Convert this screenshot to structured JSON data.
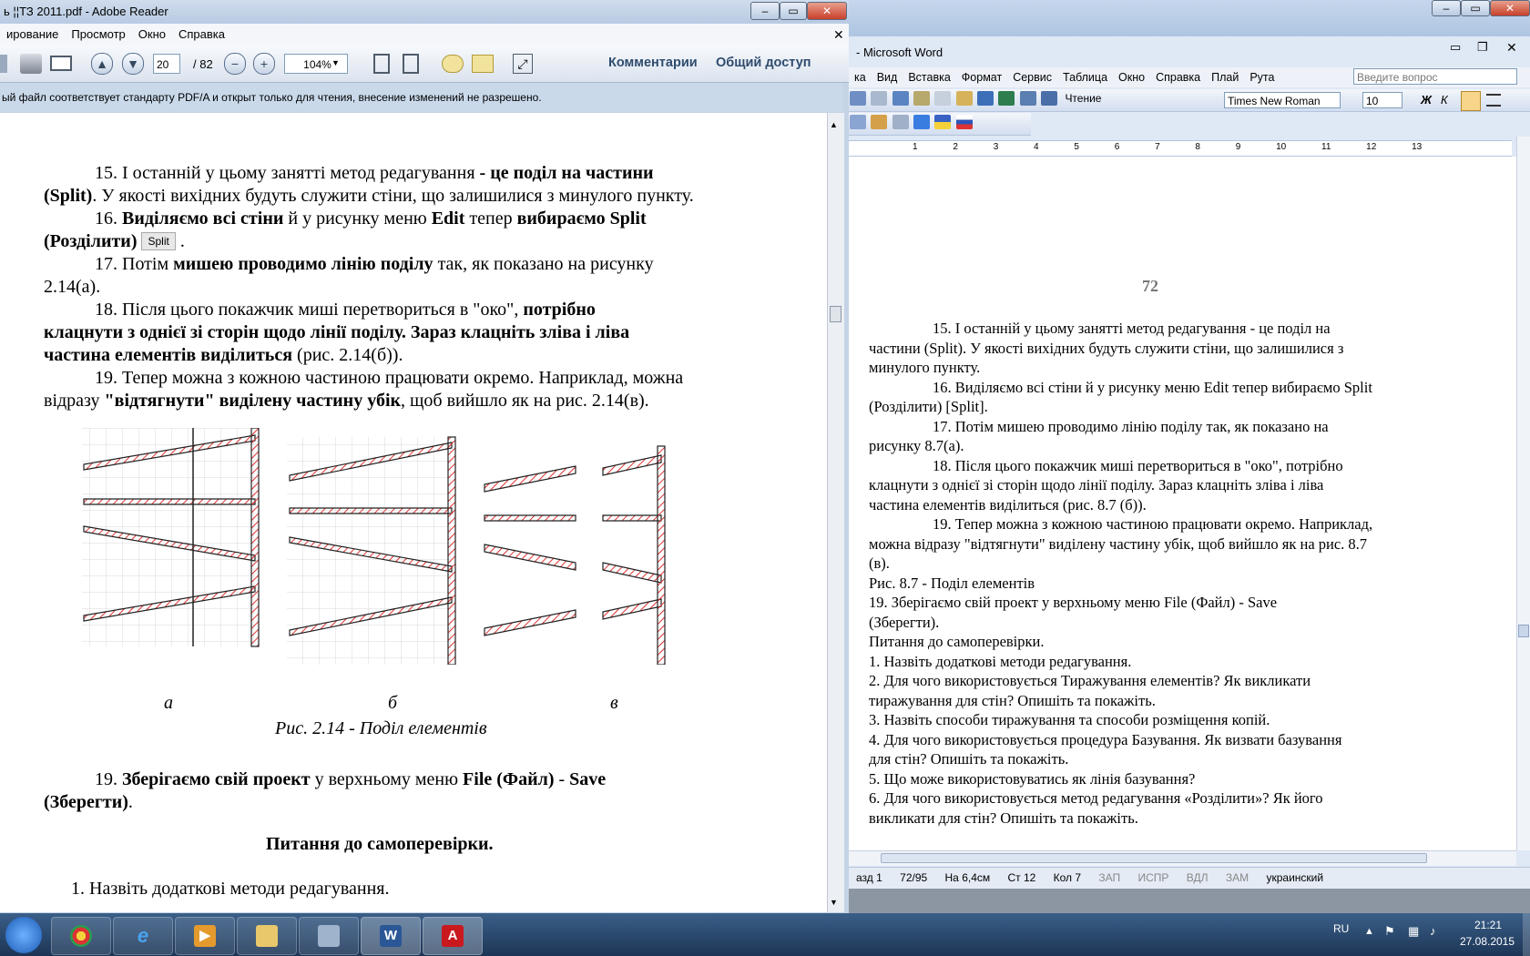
{
  "word": {
    "title": "- Microsoft Word",
    "menu": [
      "ка",
      "Вид",
      "Вставка",
      "Формат",
      "Сервис",
      "Таблица",
      "Окно",
      "Справка",
      "Плай",
      "Рута"
    ],
    "ask_placeholder": "Введите вопрос",
    "reading_label": "Чтение",
    "font_name": "Times New Roman",
    "font_size": "10",
    "bold_label": "Ж",
    "italic_label": "К",
    "ruler_numbers": [
      "1",
      "2",
      "3",
      "4",
      "5",
      "6",
      "7",
      "8",
      "9",
      "10",
      "11",
      "12",
      "13"
    ],
    "page_number": "72",
    "lines": [
      {
        "text": "15. І останній у цьому занятті метод редагування - це поділ на",
        "indent": true
      },
      {
        "text": "частини (Split). У якості вихідних будуть служити стіни, що залишилися з",
        "indent": false
      },
      {
        "text": "минулого пункту.",
        "indent": false
      },
      {
        "text": "16. Виділяємо всі стіни й у рисунку меню Edit тепер вибираємо Split",
        "indent": true
      },
      {
        "text": "(Розділити) [Split].",
        "indent": false
      },
      {
        "text": "17. Потім мишею проводимо лінію поділу так, як показано на",
        "indent": true
      },
      {
        "text": "рисунку 8.7(а).",
        "indent": false
      },
      {
        "text": "18. Після цього покажчик миші перетвориться в \"око\", потрібно",
        "indent": true
      },
      {
        "text": "клацнути з однієї зі сторін щодо лінії поділу. Зараз клацніть зліва і ліва",
        "indent": false
      },
      {
        "text": "частина елементів виділиться (рис. 8.7 (б)).",
        "indent": false
      },
      {
        "text": "19. Тепер можна з кожною частиною працювати окремо. Наприклад,",
        "indent": true
      },
      {
        "text": "можна відразу \"відтягнути\" виділену частину убік, щоб вийшло як на рис. 8.7",
        "indent": false
      },
      {
        "text": "(в).",
        "indent": false
      },
      {
        "text": "Рис. 8.7 - Поділ елементів",
        "indent": false
      },
      {
        "text": "19. Зберігаємо свій проект у верхньому меню File (Файл) - Save",
        "indent": false
      },
      {
        "text": "(Зберегти).",
        "indent": false
      },
      {
        "text": "Питання до самоперевірки.",
        "indent": false
      },
      {
        "text": "1. Назвіть додаткові методи редагування.",
        "indent": false
      },
      {
        "text": "2. Для чого використовується Тиражування елементів? Як викликати",
        "indent": false
      },
      {
        "text": "тиражування для стін? Опишіть та покажіть.",
        "indent": false
      },
      {
        "text": "3. Назвіть способи тиражування та способи розміщення копій.",
        "indent": false
      },
      {
        "text": "4. Для чого використовується процедура Базування. Як визвати базування",
        "indent": false
      },
      {
        "text": "для стін? Опишіть та покажіть.",
        "indent": false
      },
      {
        "text": "5. Що може використовуватись як лінія базування?",
        "indent": false
      },
      {
        "text": "6. Для чого використовується метод редагування «Розділити»? Як його",
        "indent": false
      },
      {
        "text": "викликати для стін? Опишіть та покажіть.",
        "indent": false
      }
    ],
    "status": [
      "азд 1",
      "72/95",
      "На 6,4см",
      "Ст 12",
      "Кол 7",
      "ЗАП",
      "ИСПР",
      "ВДЛ",
      "ЗАМ",
      "украинский"
    ]
  },
  "adobe": {
    "title": "ь ¦¦ТЗ 2011.pdf - Adobe Reader",
    "menu": [
      "ирование",
      "Просмотр",
      "Окно",
      "Справка"
    ],
    "page_current": "20",
    "page_total": "/ 82",
    "zoom": "104%",
    "comments_label": "Комментарии",
    "share_label": "Общий доступ",
    "notice": "ый файл соответствует стандарту PDF/A и открыт только для чтения, внесение изменений не разрешено.",
    "split_button_label": "Split",
    "fig_labels": [
      "а",
      "б",
      "в"
    ],
    "fig_caption": "Рис. 2.14 - Поділ елементів",
    "p15a": "15. І останній у цьому занятті метод редагування",
    "p15b": " - це ",
    "p15c": "поділ на частини",
    "p15d": "(Split)",
    "p15e": ". У якості вихідних будуть служити стіни, що залишилися з минулого пункту.",
    "p16a": "16. ",
    "p16b": "Виділяємо всі стіни",
    "p16c": " й у рисунку меню ",
    "p16d": "Edit",
    "p16e": " тепер ",
    "p16f": "вибираємо Split",
    "p16g": "(Розділити)",
    "p17a": "17. Потім ",
    "p17b": "мишею проводимо лінію поділу",
    "p17c": " так, як показано на рисунку",
    "p17d": "2.14(а).",
    "p18a": "18. Після цього покажчик миші перетвориться в \"око\", ",
    "p18b": "потрібно",
    "p18c": "клацнути з однієї зі сторін щодо лінії поділу. Зараз клацніть зліва і ліва",
    "p18d": "частина елементів виділиться",
    "p18e": " (рис. 2.14(б)).",
    "p19a": "19. Тепер можна з кожною частиною працювати окремо. Наприклад, можна",
    "p19b": "відразу ",
    "p19c": "\"відтягнути\" виділену частину убік",
    "p19d": ", щоб вийшло як на рис. 2.14(в).",
    "s19a": "19. ",
    "s19b": "Зберігаємо свій проект",
    "s19c": " у верхньому меню ",
    "s19d": "File (Файл)",
    "s19e": " - ",
    "s19f": "Save",
    "s19g": "(Зберегти)",
    "s19h": ".",
    "questions_heading": "Питання до самоперевірки.",
    "q1": "1.  Назвіть додаткові методи редагування."
  },
  "taskbar": {
    "lang": "RU",
    "time": "21:21",
    "date": "27.08.2015"
  }
}
